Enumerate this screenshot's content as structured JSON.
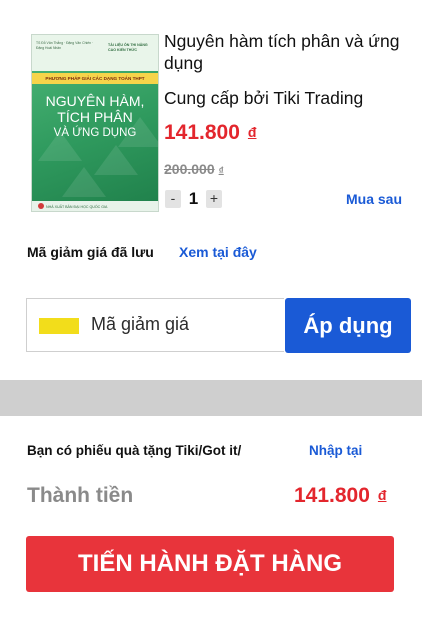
{
  "product": {
    "cover": {
      "meta_left": "TS Đỗ Văn Thắng · Đặng Văn Chiến · Đặng Hoài Nhân",
      "meta_right": "TÀI LIỆU ÔN THI NÂNG CAO KIẾN THỨC",
      "ribbon": "PHƯƠNG PHÁP GIẢI CÁC DẠNG TOÁN THPT",
      "title_line1": "NGUYÊN HÀM,",
      "title_line2": "TÍCH PHÂN",
      "title_line3": "VÀ ỨNG DỤNG",
      "publisher": "NHÀ XUẤT BẢN ĐẠI HỌC QUỐC GIA"
    },
    "title": "Nguyên hàm tích phân và ứng dụng",
    "seller": "Cung cấp bởi Tiki Trading",
    "price": "141.800",
    "currency": "đ",
    "old_price": "200.000",
    "old_currency": "₫",
    "quantity": "1",
    "minus": "-",
    "plus": "+",
    "buy_later": "Mua sau"
  },
  "coupon": {
    "saved_label": "Mã giảm giá đã lưu",
    "saved_link": "Xem tại đây",
    "placeholder": "Mã giảm giá",
    "apply": "Áp dụng"
  },
  "summary": {
    "gift_label": "Bạn có phiếu quà tặng Tiki/Got it/",
    "gift_link": "Nhập tại",
    "total_label": "Thành tiền",
    "total_value": "141.800",
    "currency": "đ"
  },
  "checkout": {
    "label": "TIẾN HÀNH ĐẶT HÀNG"
  },
  "colors": {
    "accent_blue": "#1a5ad6",
    "price_red": "#e3262d",
    "checkout_red": "#e8343b",
    "coupon_icon": "#f2dd1b"
  }
}
